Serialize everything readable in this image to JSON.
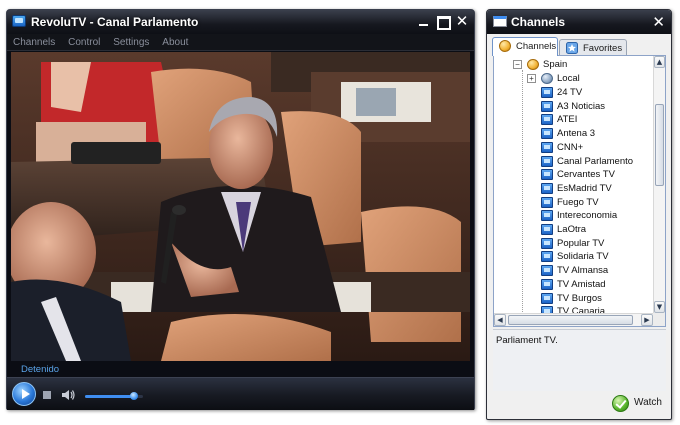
{
  "player": {
    "title": "RevoluTV - Canal Parlamento",
    "menu": [
      "Channels",
      "Control",
      "Settings",
      "About"
    ],
    "status": "Detenido",
    "volume_level": 0.85,
    "accent": "#3f8df0"
  },
  "channels_window": {
    "title": "Channels",
    "tabs": [
      {
        "label": "Channels",
        "icon": "globe-icon",
        "active": true
      },
      {
        "label": "Favorites",
        "icon": "star-icon",
        "active": false
      }
    ],
    "tree": {
      "root": {
        "label": "Spain",
        "icon": "globe-icon",
        "expanded": true
      },
      "local": {
        "label": "Local",
        "icon": "local-icon",
        "expanded": false
      },
      "channels": [
        "24 TV",
        "A3 Noticias",
        "ATEI",
        "Antena 3",
        "CNN+",
        "Canal Parlamento",
        "Cervantes TV",
        "EsMadrid TV",
        "Fuego TV",
        "Intereconomia",
        "LaOtra",
        "Popular TV",
        "Solidaria TV",
        "TV Almansa",
        "TV Amistad",
        "TV Burgos",
        "TV Canaria"
      ]
    },
    "description": "Parliament TV.",
    "watch_label": "Watch"
  }
}
